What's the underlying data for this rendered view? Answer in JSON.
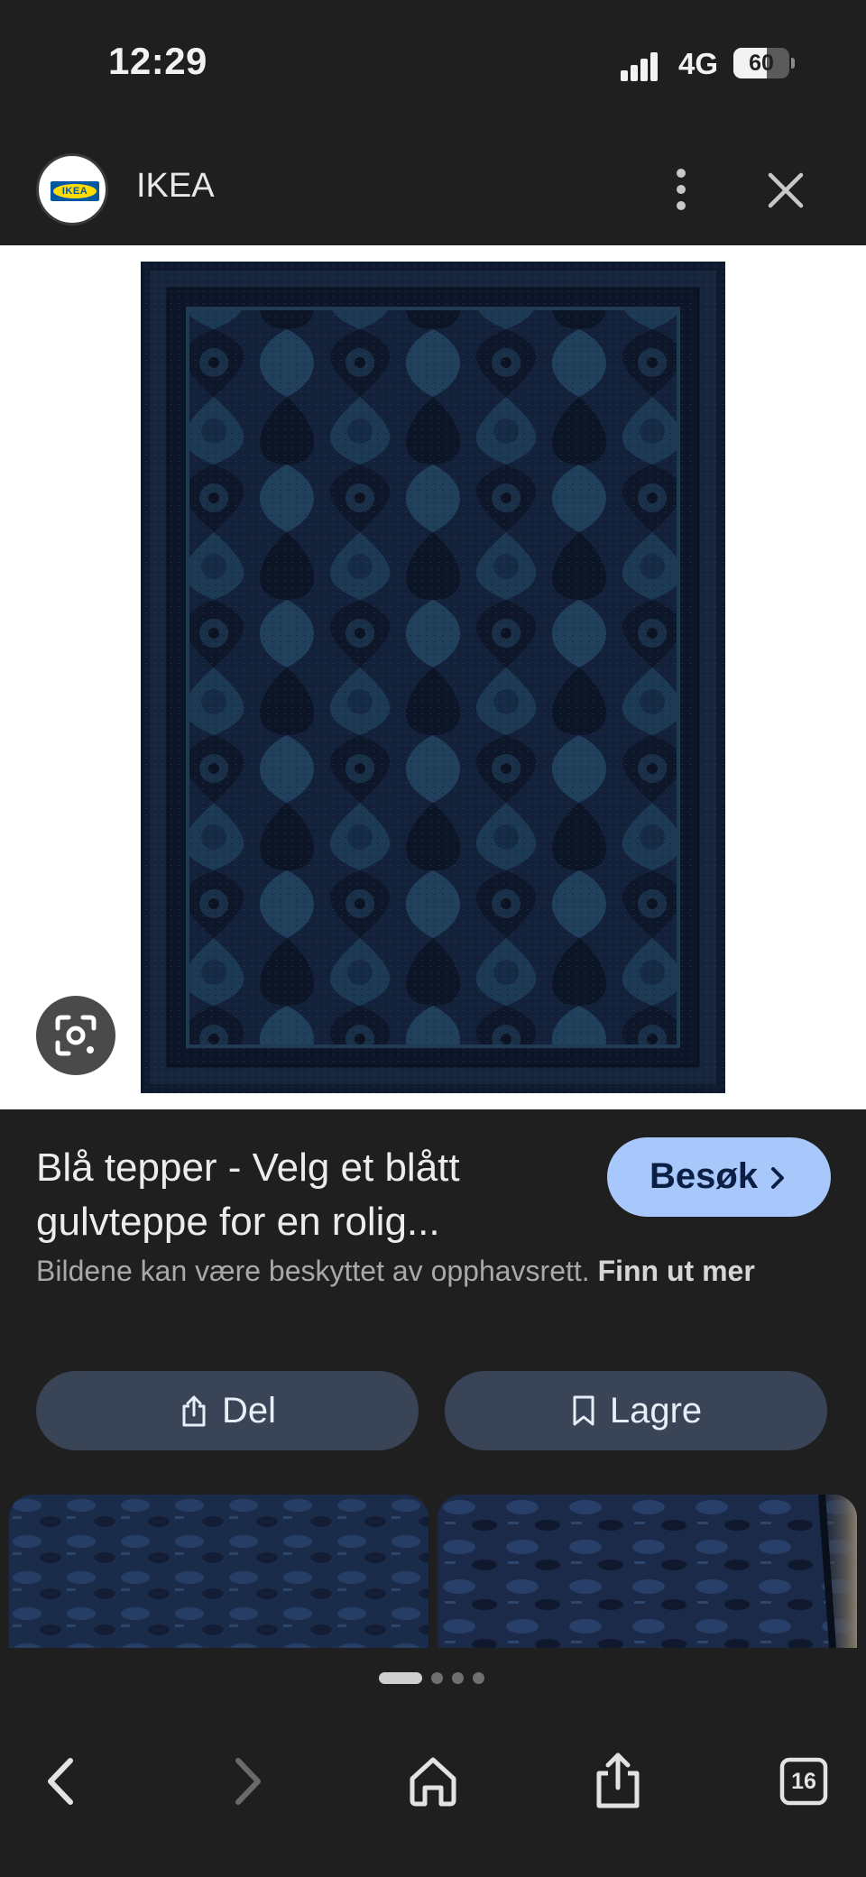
{
  "status_bar": {
    "time": "12:29",
    "network": "4G",
    "battery_level": "60",
    "battery_fraction": 0.6,
    "signal_icon": "cellular-signal-icon"
  },
  "header": {
    "logo_text": "IKEA",
    "site_name": "IKEA",
    "more_icon": "more-vert-icon",
    "close_icon": "close-icon"
  },
  "hero": {
    "alt": "dark blue rug image",
    "lens_icon": "lens-icon"
  },
  "result": {
    "title": "Blå tepper - Velg et blått gulvteppe for en rolig...",
    "visit_label": "Besøk",
    "copyright_text": "Bildene kan være beskyttet av opphavsrett.",
    "copyright_link": "Finn ut mer"
  },
  "actions": {
    "share_label": "Del",
    "save_label": "Lagre"
  },
  "related": {
    "thumbnails": [
      "related-rug-1",
      "related-rug-2"
    ],
    "page_count": 4,
    "active_page": 1
  },
  "browser_bar": {
    "tabs_count": "16",
    "back_icon": "back-icon",
    "forward_icon": "forward-icon",
    "home_icon": "home-icon",
    "share_icon": "share-icon",
    "tabs_icon": "tabs-icon"
  },
  "colors": {
    "background": "#1f1f1f",
    "visit_button": "#a8c7fa",
    "action_button": "#394457",
    "rug_dark": "#0f1a2e",
    "rug_teal": "#1f3a52"
  }
}
